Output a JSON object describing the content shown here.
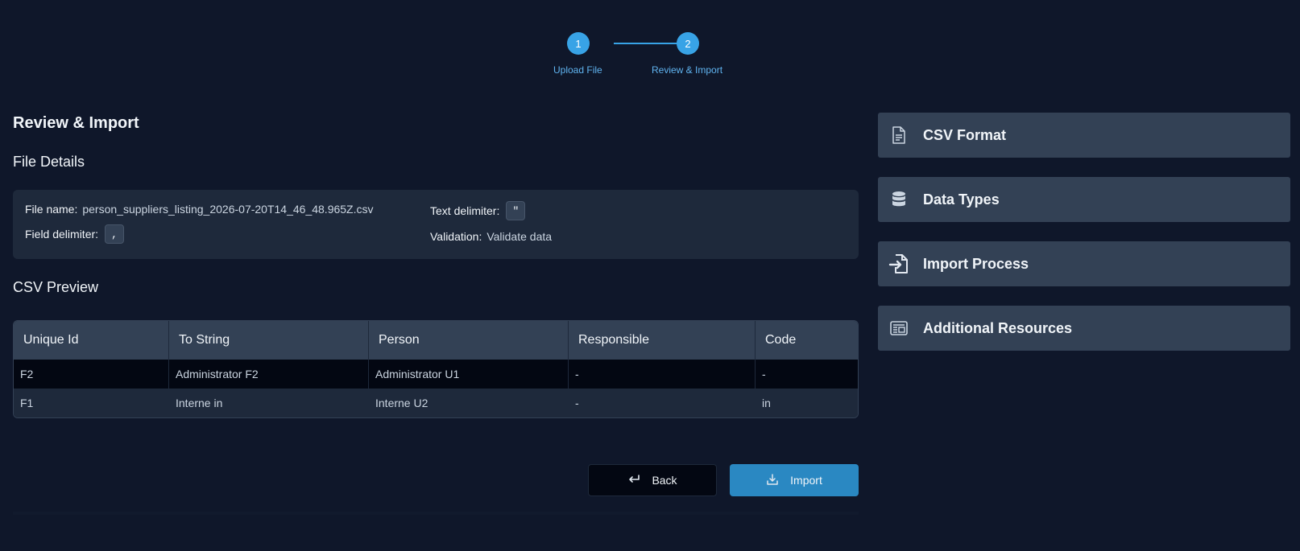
{
  "stepper": {
    "steps": [
      {
        "number": "1",
        "label": "Upload File"
      },
      {
        "number": "2",
        "label": "Review & Import"
      }
    ]
  },
  "main": {
    "title": "Review & Import",
    "file_details": {
      "heading": "File Details",
      "file_name_label": "File name:",
      "file_name": "person_suppliers_listing_2026-07-20T14_46_48.965Z.csv",
      "field_delimiter_label": "Field delimiter:",
      "field_delimiter": ",",
      "text_delimiter_label": "Text delimiter:",
      "text_delimiter": "\"",
      "validation_label": "Validation:",
      "validation": "Validate data"
    },
    "csv_preview": {
      "heading": "CSV Preview",
      "columns": [
        "Unique Id",
        "To String",
        "Person",
        "Responsible",
        "Code"
      ],
      "rows": [
        [
          "F2",
          "Administrator F2",
          "Administrator U1",
          "-",
          "-"
        ],
        [
          "F1",
          "Interne in",
          "Interne U2",
          "-",
          "in"
        ]
      ]
    },
    "buttons": {
      "back": "Back",
      "import": "Import"
    }
  },
  "sidebar": {
    "panels": [
      {
        "label": "CSV Format",
        "icon": "document-icon"
      },
      {
        "label": "Data Types",
        "icon": "database-icon"
      },
      {
        "label": "Import Process",
        "icon": "file-import-icon"
      },
      {
        "label": "Additional Resources",
        "icon": "newspaper-icon"
      }
    ]
  }
}
